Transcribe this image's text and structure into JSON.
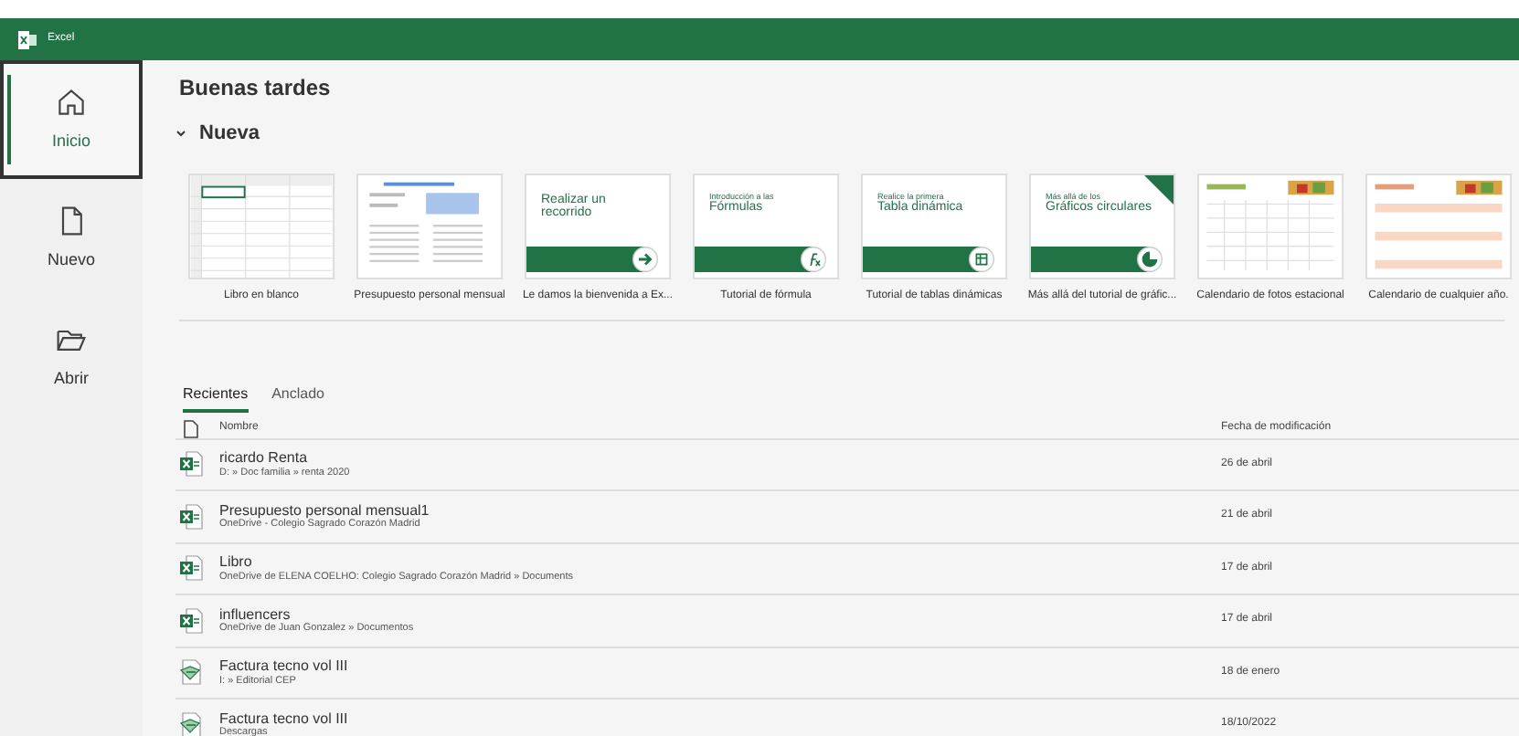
{
  "app": {
    "title": "Excel"
  },
  "sidebar": {
    "items": [
      {
        "label": "Inicio",
        "selected": true
      },
      {
        "label": "Nuevo",
        "selected": false
      },
      {
        "label": "Abrir",
        "selected": false
      }
    ]
  },
  "greeting": "Buenas tardes",
  "new_section": {
    "title": "Nueva",
    "expanded": true,
    "templates": [
      {
        "kind": "blank",
        "label": "Libro en blanco"
      },
      {
        "kind": "budget",
        "label": "Presupuesto personal mensual"
      },
      {
        "kind": "tour",
        "headline": "Realizar un recorrido",
        "label": "Le damos la bienvenida a Ex..."
      },
      {
        "kind": "tour",
        "intro": "Introducción a las",
        "headline": "Fórmulas",
        "label": "Tutorial de fórmula"
      },
      {
        "kind": "tour",
        "intro": "Realice la primera",
        "headline": "Tabla dinámica",
        "label": "Tutorial de tablas dinámicas"
      },
      {
        "kind": "tour",
        "intro": "Más allá de los",
        "headline": "Gráficos circulares",
        "label": "Más allá del tutorial de gráfic..."
      },
      {
        "kind": "calendar",
        "label": "Calendario de fotos estacional"
      },
      {
        "kind": "calendar_any",
        "label": "Calendario de cualquier año."
      }
    ]
  },
  "files": {
    "tabs": [
      {
        "label": "Recientes",
        "selected": true
      },
      {
        "label": "Anclado",
        "selected": false
      }
    ],
    "columns": [
      "Nombre",
      "Fecha de modificación"
    ],
    "rows": [
      {
        "kind": "xlsx",
        "name": "ricardo Renta",
        "path": "D: » Doc familia » renta 2020",
        "date": "26 de abril"
      },
      {
        "kind": "xlsx",
        "name": "Presupuesto personal mensual1",
        "path": "OneDrive - Colegio Sagrado Corazón Madrid",
        "date": "21 de abril"
      },
      {
        "kind": "xlsx",
        "name": "Libro",
        "path": "OneDrive de ELENA COELHO: Colegio Sagrado Corazón Madrid » Documents",
        "date": "17 de abril"
      },
      {
        "kind": "xlsx",
        "name": "influencers",
        "path": "OneDrive de Juan Gonzalez » Documentos",
        "date": "17 de abril"
      },
      {
        "kind": "xml",
        "name": "Factura tecno vol III",
        "path": "I: » Editorial CEP",
        "date": "18 de enero"
      },
      {
        "kind": "xml",
        "name": "Factura tecno vol III",
        "path": "Descargas",
        "date": "18/10/2022"
      }
    ]
  }
}
